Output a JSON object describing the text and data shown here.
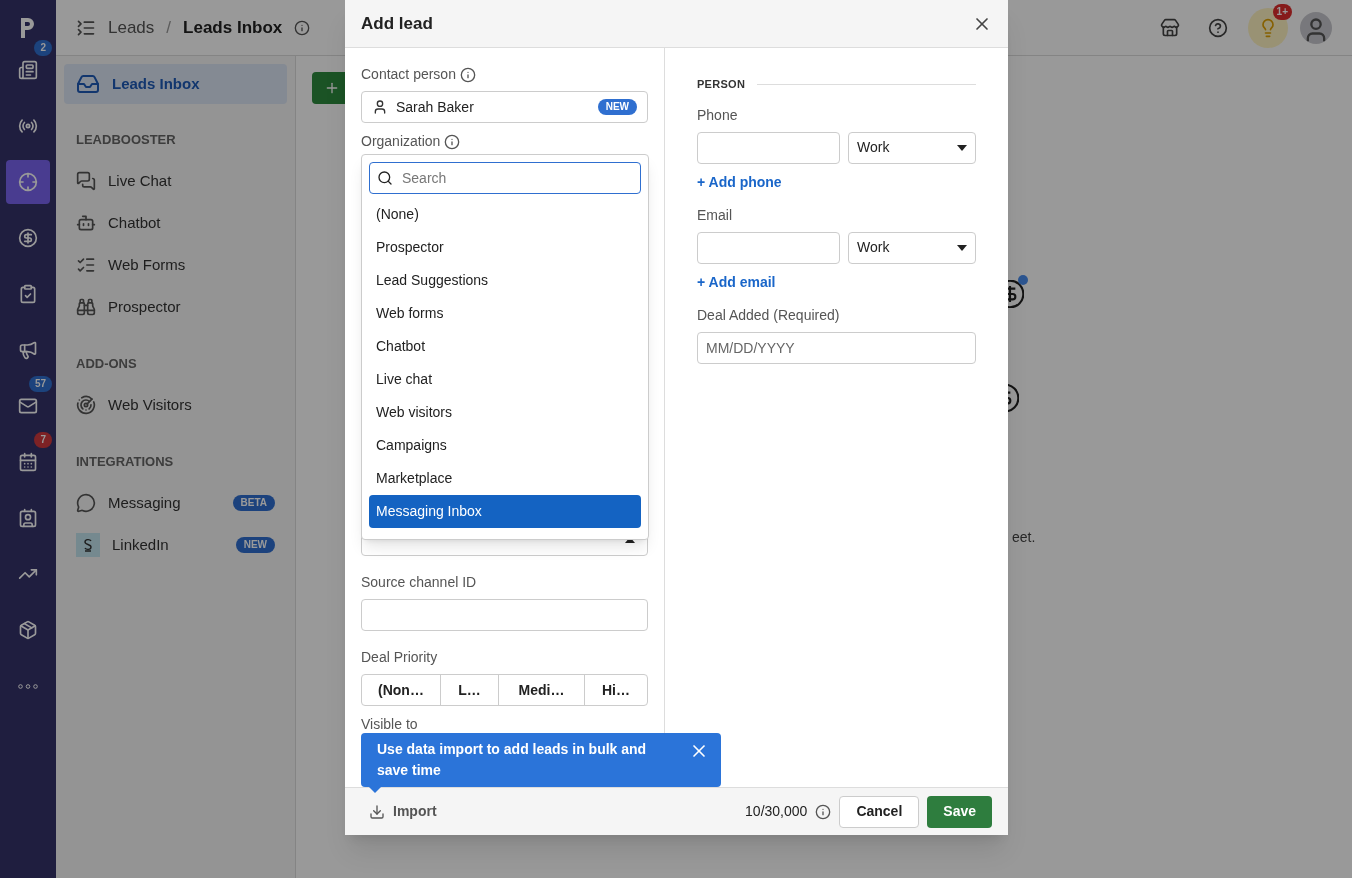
{
  "rail": [
    {
      "badge": "2",
      "color": "#1c437d",
      "selected": false
    },
    {
      "selected": false
    },
    {
      "selected": true
    },
    {
      "selected": false
    },
    {
      "selected": false
    },
    {
      "selected": false
    },
    {
      "badge": "57",
      "color": "#1c437d",
      "selected": false
    },
    {
      "badge": "7",
      "color": "#7d2225",
      "selected": false
    },
    {
      "selected": false
    },
    {
      "selected": false
    },
    {
      "selected": false
    },
    {
      "selected": false
    }
  ],
  "topbar": {
    "breadcrumb": [
      "Leads",
      "Leads Inbox"
    ],
    "separator": "/",
    "notification_badge": "1+"
  },
  "sidebar": {
    "items": [
      {
        "label": "Leads Inbox",
        "selected": true
      }
    ],
    "sections": [
      {
        "title": "LEADBOOSTER",
        "items": [
          {
            "label": "Live Chat",
            "selected": false
          },
          {
            "label": "Chatbot",
            "selected": false
          },
          {
            "label": "Web Forms",
            "selected": false
          },
          {
            "label": "Prospector",
            "selected": false
          }
        ]
      },
      {
        "title": "ADD-ONS",
        "items": [
          {
            "label": "Web Visitors",
            "selected": false
          }
        ]
      },
      {
        "title": "INTEGRATIONS",
        "items": [
          {
            "label": "Messaging",
            "selected": false,
            "badge": "BETA"
          },
          {
            "label": "LinkedIn",
            "selected": false,
            "badge": "NEW"
          }
        ]
      }
    ]
  },
  "main": {
    "hint_tail": "eet."
  },
  "modal": {
    "title": "Add lead",
    "contact": {
      "label": "Contact person",
      "value": "Sarah Baker",
      "badge": "NEW"
    },
    "organization": {
      "label": "Organization"
    },
    "dropdown": {
      "placeholder": "Search",
      "options": [
        {
          "label": "(None)",
          "selected": false
        },
        {
          "label": "Prospector",
          "selected": false
        },
        {
          "label": "Lead Suggestions",
          "selected": false
        },
        {
          "label": "Web forms",
          "selected": false
        },
        {
          "label": "Chatbot",
          "selected": false
        },
        {
          "label": "Live chat",
          "selected": false
        },
        {
          "label": "Web visitors",
          "selected": false
        },
        {
          "label": "Campaigns",
          "selected": false
        },
        {
          "label": "Marketplace",
          "selected": false
        },
        {
          "label": "Messaging Inbox",
          "selected": true
        }
      ]
    },
    "source_channel_id": {
      "label": "Source channel ID"
    },
    "deal_priority": {
      "label": "Deal Priority",
      "options": [
        "(Non…",
        "L…",
        "Medi…",
        "Hi…"
      ]
    },
    "visible_to": {
      "label": "Visible to"
    },
    "person": {
      "heading": "PERSON",
      "phone": {
        "label": "Phone",
        "type": "Work",
        "add": "+ Add phone"
      },
      "email": {
        "label": "Email",
        "type": "Work",
        "add": "+ Add email"
      },
      "deal_added": {
        "label": "Deal Added (Required)",
        "placeholder": "MM/DD/YYYY"
      }
    },
    "tooltip": "Use data import to add leads in bulk and save time",
    "footer": {
      "import": "Import",
      "count": "10/30,000",
      "cancel": "Cancel",
      "save": "Save"
    }
  }
}
